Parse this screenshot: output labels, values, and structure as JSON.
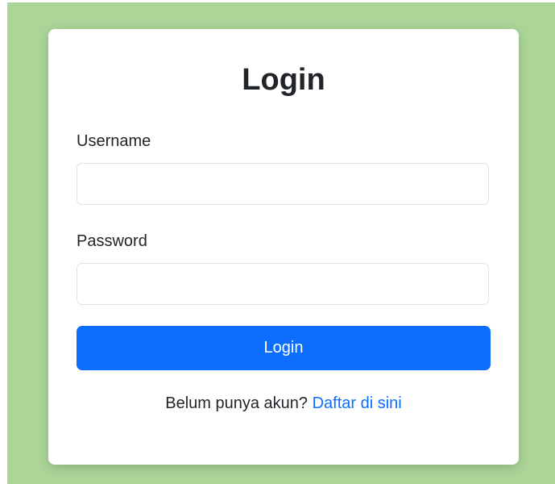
{
  "colors": {
    "page_background": "#acd598",
    "card_background": "#ffffff",
    "primary": "#0d6efd",
    "text": "#212529",
    "input_border": "#dee2e6"
  },
  "login": {
    "title": "Login",
    "username_label": "Username",
    "username_value": "",
    "password_label": "Password",
    "password_value": "",
    "submit_label": "Login",
    "register_prompt": "Belum punya akun?",
    "register_link": "Daftar di sini"
  }
}
